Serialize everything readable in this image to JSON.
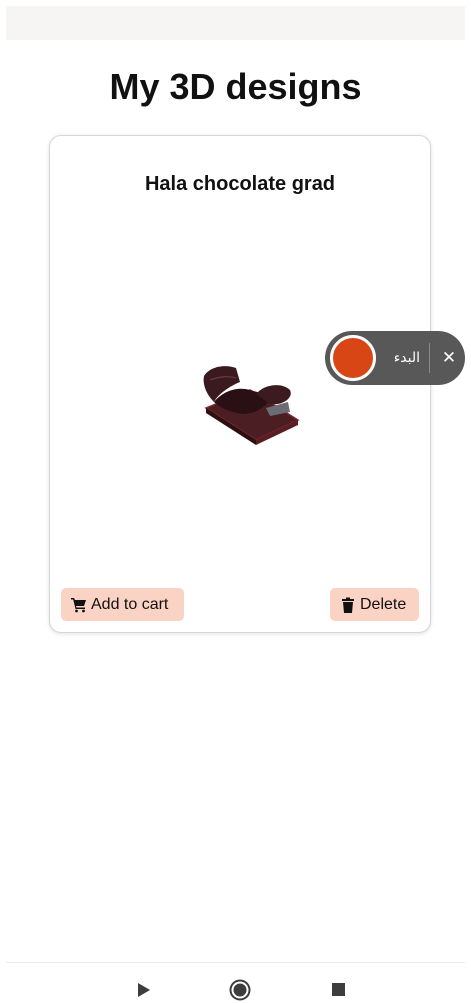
{
  "page": {
    "title": "My 3D designs"
  },
  "design_card": {
    "title": "Hala chocolate grad",
    "model_alt": "chocolate graduation cap 3D model",
    "add_to_cart_label": "Add to cart",
    "delete_label": "Delete",
    "icons": {
      "cart": "shopping-cart-icon",
      "delete": "trash-icon"
    }
  },
  "screen_recorder": {
    "start_label": "البدء",
    "close_symbol": "✕",
    "colors": {
      "record": "#d94616",
      "pill": "#585858"
    }
  },
  "nav_bar": {
    "back": "back-icon",
    "home": "home-icon",
    "recents": "recents-icon"
  },
  "colors": {
    "button_bg": "#fbd3c4"
  }
}
